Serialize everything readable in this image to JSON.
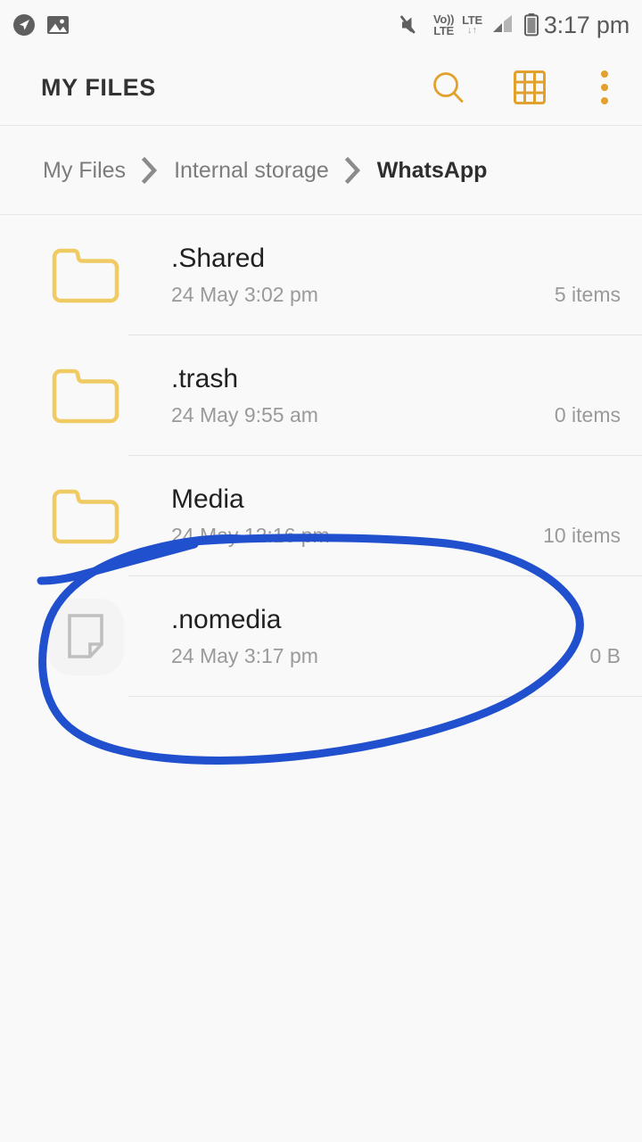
{
  "status_bar": {
    "left_icons": [
      {
        "name": "location-arrow-icon",
        "glyph": "navigation"
      },
      {
        "name": "gallery-image-icon",
        "glyph": "image"
      }
    ],
    "right_icons": [
      {
        "name": "mute-icon",
        "glyph": "speaker-muted"
      },
      {
        "name": "volte-icon",
        "line1": "Vo))",
        "line2": "LTE"
      },
      {
        "name": "lte-data-icon",
        "line1": "LTE",
        "line2": "↓↑"
      },
      {
        "name": "signal-bars-icon",
        "glyph": "signal"
      },
      {
        "name": "battery-icon",
        "glyph": "battery"
      }
    ],
    "time": "3:17 pm"
  },
  "app_bar": {
    "title": "MY FILES",
    "actions": [
      {
        "name": "search-icon",
        "label": "Search"
      },
      {
        "name": "grid-view-icon",
        "label": "Grid view"
      },
      {
        "name": "more-options-icon",
        "label": "More options"
      }
    ]
  },
  "breadcrumb": {
    "separator": "›",
    "items": [
      {
        "label": "My Files",
        "current": false
      },
      {
        "label": "Internal storage",
        "current": false
      },
      {
        "label": "WhatsApp",
        "current": true
      }
    ]
  },
  "file_list": [
    {
      "name": ".Shared",
      "date": "24 May 3:02 pm",
      "size": "5 items",
      "icon": "folder-icon",
      "type": "folder"
    },
    {
      "name": ".trash",
      "date": "24 May 9:55 am",
      "size": "0 items",
      "icon": "folder-icon",
      "type": "folder"
    },
    {
      "name": "Media",
      "date": "24 May 12:16 pm",
      "size": "10 items",
      "icon": "folder-icon",
      "type": "folder"
    },
    {
      "name": ".nomedia",
      "date": "24 May 3:17 pm",
      "size": "0 B",
      "icon": "file-document-icon",
      "type": "file"
    }
  ],
  "annotation": {
    "name": "handdrawn-circle-annotation",
    "shape": "ellipse-with-tail",
    "color": "#2150CE",
    "stroke_width": 9,
    "target": ".nomedia"
  },
  "colors": {
    "accent": "#E2A12C",
    "folder": "#F0CB63",
    "background": "#F9F9F9",
    "divider": "#E3E3E3",
    "primary_text": "#212121",
    "secondary_text": "#9A9A9A",
    "annotation_blue": "#2150CE"
  }
}
